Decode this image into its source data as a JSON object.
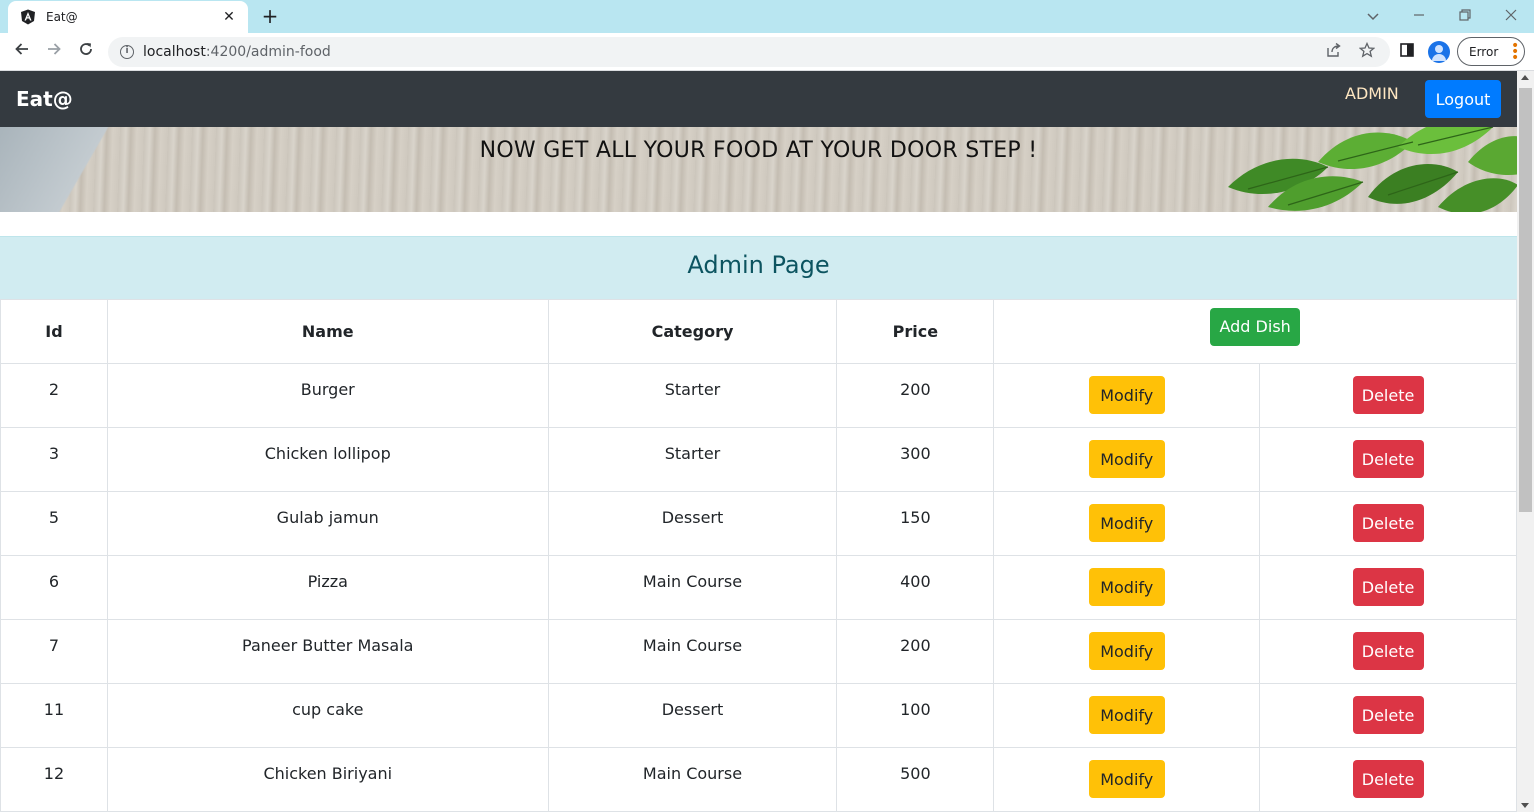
{
  "browser": {
    "tab_title": "Eat@",
    "tab_close": "✕",
    "new_tab": "+",
    "url_host": "localhost",
    "url_path": ":4200/admin-food",
    "error_label": "Error",
    "icons": [
      "angular-favicon-icon",
      "back-arrow-icon",
      "forward-arrow-icon",
      "reload-icon",
      "site-info-icon",
      "share-icon",
      "star-icon",
      "sidepanel-icon",
      "profile-icon",
      "menu-dots-icon",
      "tab-search-icon",
      "minimize-icon",
      "restore-icon",
      "close-icon"
    ]
  },
  "navbar": {
    "brand": "Eat@",
    "admin_link": "ADMIN",
    "logout_label": "Logout"
  },
  "banner": {
    "text": "NOW GET ALL YOUR FOOD AT YOUR DOOR STEP !"
  },
  "admin": {
    "title": "Admin Page"
  },
  "table": {
    "headers": {
      "id": "Id",
      "name": "Name",
      "category": "Category",
      "price": "Price"
    },
    "add_label": "Add Dish",
    "modify_label": "Modify",
    "delete_label": "Delete",
    "rows": [
      {
        "id": "2",
        "name": "Burger",
        "category": "Starter",
        "price": "200"
      },
      {
        "id": "3",
        "name": "Chicken lollipop",
        "category": "Starter",
        "price": "300"
      },
      {
        "id": "5",
        "name": "Gulab jamun",
        "category": "Dessert",
        "price": "150"
      },
      {
        "id": "6",
        "name": "Pizza",
        "category": "Main Course",
        "price": "400"
      },
      {
        "id": "7",
        "name": "Paneer Butter Masala",
        "category": "Main Course",
        "price": "200"
      },
      {
        "id": "11",
        "name": "cup cake",
        "category": "Dessert",
        "price": "100"
      },
      {
        "id": "12",
        "name": "Chicken Biriyani",
        "category": "Main Course",
        "price": "500"
      }
    ]
  },
  "colors": {
    "navbar": "#343a40",
    "primary": "#007bff",
    "success": "#28a745",
    "warning": "#ffc107",
    "danger": "#dc3545",
    "info_bg": "#d1ecf1",
    "info_text": "#0c5460"
  }
}
